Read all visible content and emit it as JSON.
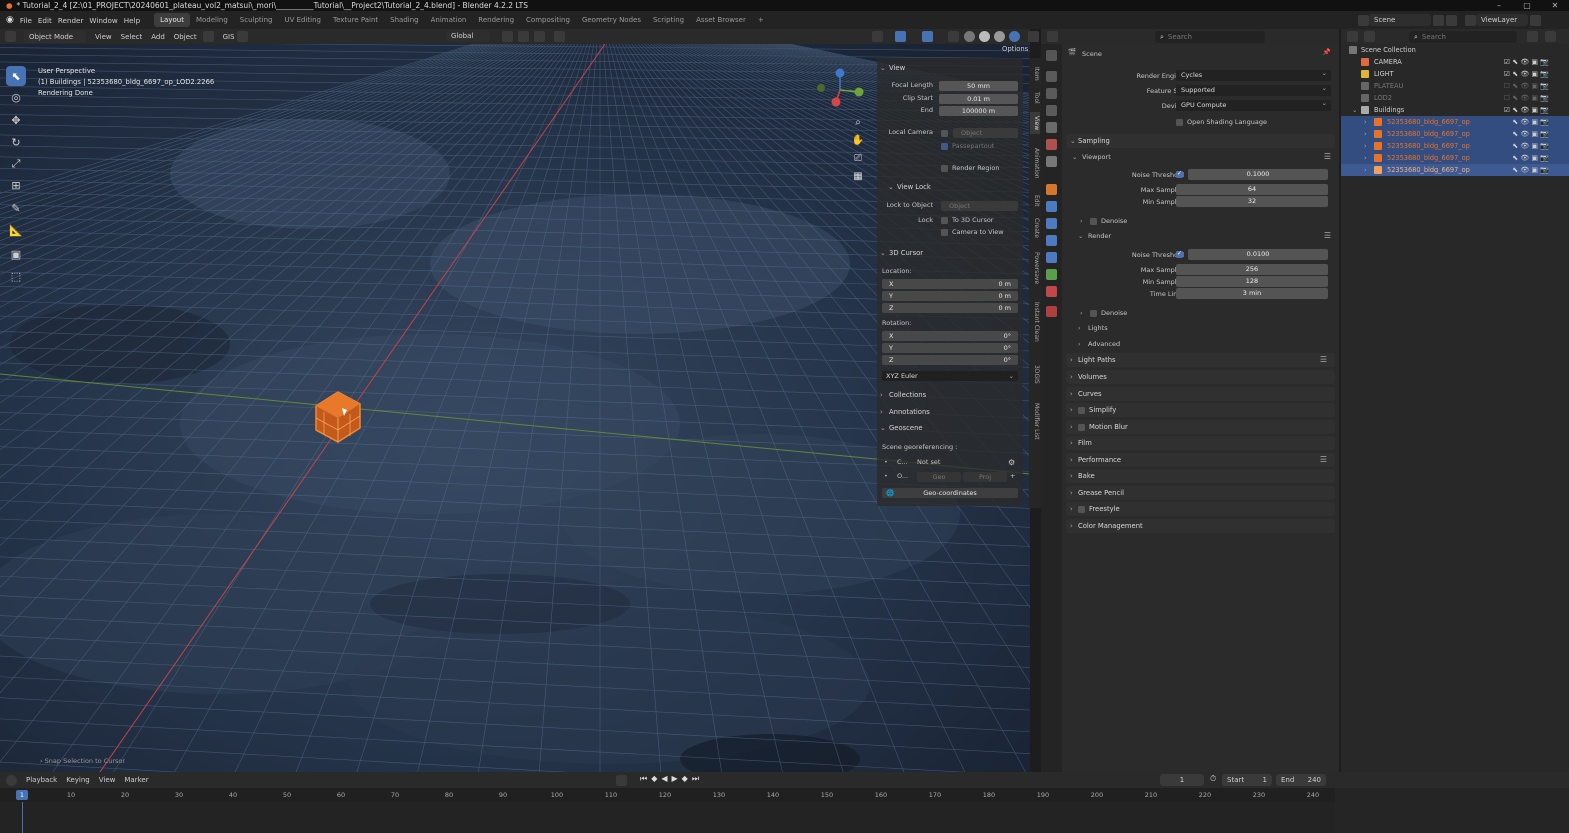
{
  "title_bar": {
    "text": "* Tutorial_2_4 [Z:\\01_PROJECT\\20240601_plateau_vol2_matsui\\_mori\\__________Tutorial\\__Project2\\Tutorial_2_4.blend] - Blender 4.2.2 LTS",
    "minimize": "–",
    "maximize": "▢",
    "close": "✕"
  },
  "menu": [
    "File",
    "Edit",
    "Render",
    "Window",
    "Help"
  ],
  "workspaces": [
    "Layout",
    "Modeling",
    "Sculpting",
    "UV Editing",
    "Texture Paint",
    "Shading",
    "Animation",
    "Rendering",
    "Compositing",
    "Geometry Nodes",
    "Scripting",
    "Asset Browser"
  ],
  "workspace_add": "+",
  "scene_selector": {
    "label": "Scene",
    "view_layer": "ViewLayer"
  },
  "viewport_header": {
    "mode": "Object Mode",
    "menus": [
      "View",
      "Select",
      "Add",
      "Object"
    ],
    "gis": "GIS",
    "orientation": "Global",
    "options": "Options"
  },
  "viewport_info": {
    "line1": "User Perspective",
    "line2": "(1) Buildings | 52353680_bldg_6697_op_LOD2.2266",
    "line3": "Rendering Done"
  },
  "status_left": "Snap Selection to Cursor",
  "npanel": {
    "view_title": "View",
    "focal_length_label": "Focal Length",
    "focal_length": "50 mm",
    "clip_start_label": "Clip Start",
    "clip_start": "0.01 m",
    "end_label": "End",
    "end": "100000 m",
    "local_camera_label": "Local Camera",
    "local_camera_value": "Object",
    "passepartout": "Passepartout",
    "render_region": "Render Region",
    "view_lock_title": "View Lock",
    "lock_to_object_label": "Lock to Object",
    "lock_to_object_value": "Object",
    "lock_label": "Lock",
    "to_3d_cursor": "To 3D Cursor",
    "camera_to_view": "Camera to View",
    "cursor_title": "3D Cursor",
    "location_label": "Location:",
    "loc": [
      {
        "axis": "X",
        "value": "0 m"
      },
      {
        "axis": "Y",
        "value": "0 m"
      },
      {
        "axis": "Z",
        "value": "0 m"
      }
    ],
    "rotation_label": "Rotation:",
    "rot": [
      {
        "axis": "X",
        "value": "0°"
      },
      {
        "axis": "Y",
        "value": "0°"
      },
      {
        "axis": "Z",
        "value": "0°"
      }
    ],
    "rotation_mode": "XYZ Euler",
    "collections": "Collections",
    "annotations": "Annotations",
    "geoscene": "Geoscene",
    "scene_georef": "Scene georeferencing :",
    "crs_short": "C...",
    "not_set": "Not set",
    "origin_short": "O...",
    "geo_btn": "Geo",
    "proj_btn": "Proj",
    "geo_coordinates": "Geo-coordinates"
  },
  "npanel_tabs": [
    "Item",
    "Tool",
    "View",
    "Animation",
    "Edit",
    "Create",
    "Powersave",
    "Instant Clean",
    "3DGIS",
    "Modifier List"
  ],
  "properties": {
    "scene_label": "Scene",
    "render_engine_label": "Render Engine",
    "render_engine": "Cycles",
    "feature_set_label": "Feature Set",
    "feature_set": "Supported",
    "device_label": "Device",
    "device": "GPU Compute",
    "osl": "Open Shading Language",
    "sampling": "Sampling",
    "viewport": "Viewport",
    "vp_noise_label": "Noise Threshold",
    "vp_noise": "0.1000",
    "vp_max_label": "Max Samples",
    "vp_max": "64",
    "vp_min_label": "Min Samples",
    "vp_min": "32",
    "denoise": "Denoise",
    "render": "Render",
    "r_noise_label": "Noise Threshold",
    "r_noise": "0.0100",
    "r_max_label": "Max Samples",
    "r_max": "256",
    "r_min_label": "Min Samples",
    "r_min": "128",
    "r_time_label": "Time Limit",
    "r_time": "3 min",
    "denoise2": "Denoise",
    "lights": "Lights",
    "advanced": "Advanced",
    "sections": [
      "Light Paths",
      "Volumes",
      "Curves",
      "Simplify",
      "Motion Blur",
      "Film",
      "Performance",
      "Bake",
      "Grease Pencil",
      "Freestyle",
      "Color Management"
    ]
  },
  "outliner": {
    "root": "Scene Collection",
    "items": [
      {
        "name": "CAMERA",
        "color": "#e06a3c"
      },
      {
        "name": "LIGHT",
        "color": "#e0b43c"
      },
      {
        "name": "PLATEAU",
        "color": "#9a9a9a"
      },
      {
        "name": "LOD2",
        "color": "#9a9a9a"
      },
      {
        "name": "Buildings",
        "color": "#9a9a9a"
      }
    ],
    "children": [
      "52353680_bldg_6697_op",
      "52353680_bldg_6697_op",
      "52353680_bldg_6697_op",
      "52353680_bldg_6697_op",
      "52353680_bldg_6697_op"
    ],
    "search_placeholder": "Search"
  },
  "timeline": {
    "menus": [
      "Playback",
      "Keying",
      "View",
      "Marker"
    ],
    "current_frame": "1",
    "start_label": "Start",
    "start": "1",
    "end_label": "End",
    "end": "240",
    "ticks": [
      "10",
      "20",
      "30",
      "40",
      "50",
      "60",
      "70",
      "80",
      "90",
      "100",
      "110",
      "120",
      "130",
      "140",
      "150",
      "160",
      "170",
      "180",
      "190",
      "200",
      "210",
      "220",
      "230",
      "240"
    ]
  },
  "colors": {
    "accent": "#4772b3",
    "selected_object": "#e8722a",
    "x_axis": "#d8464a",
    "y_axis": "#6fa538",
    "z_axis": "#3f78c8"
  }
}
